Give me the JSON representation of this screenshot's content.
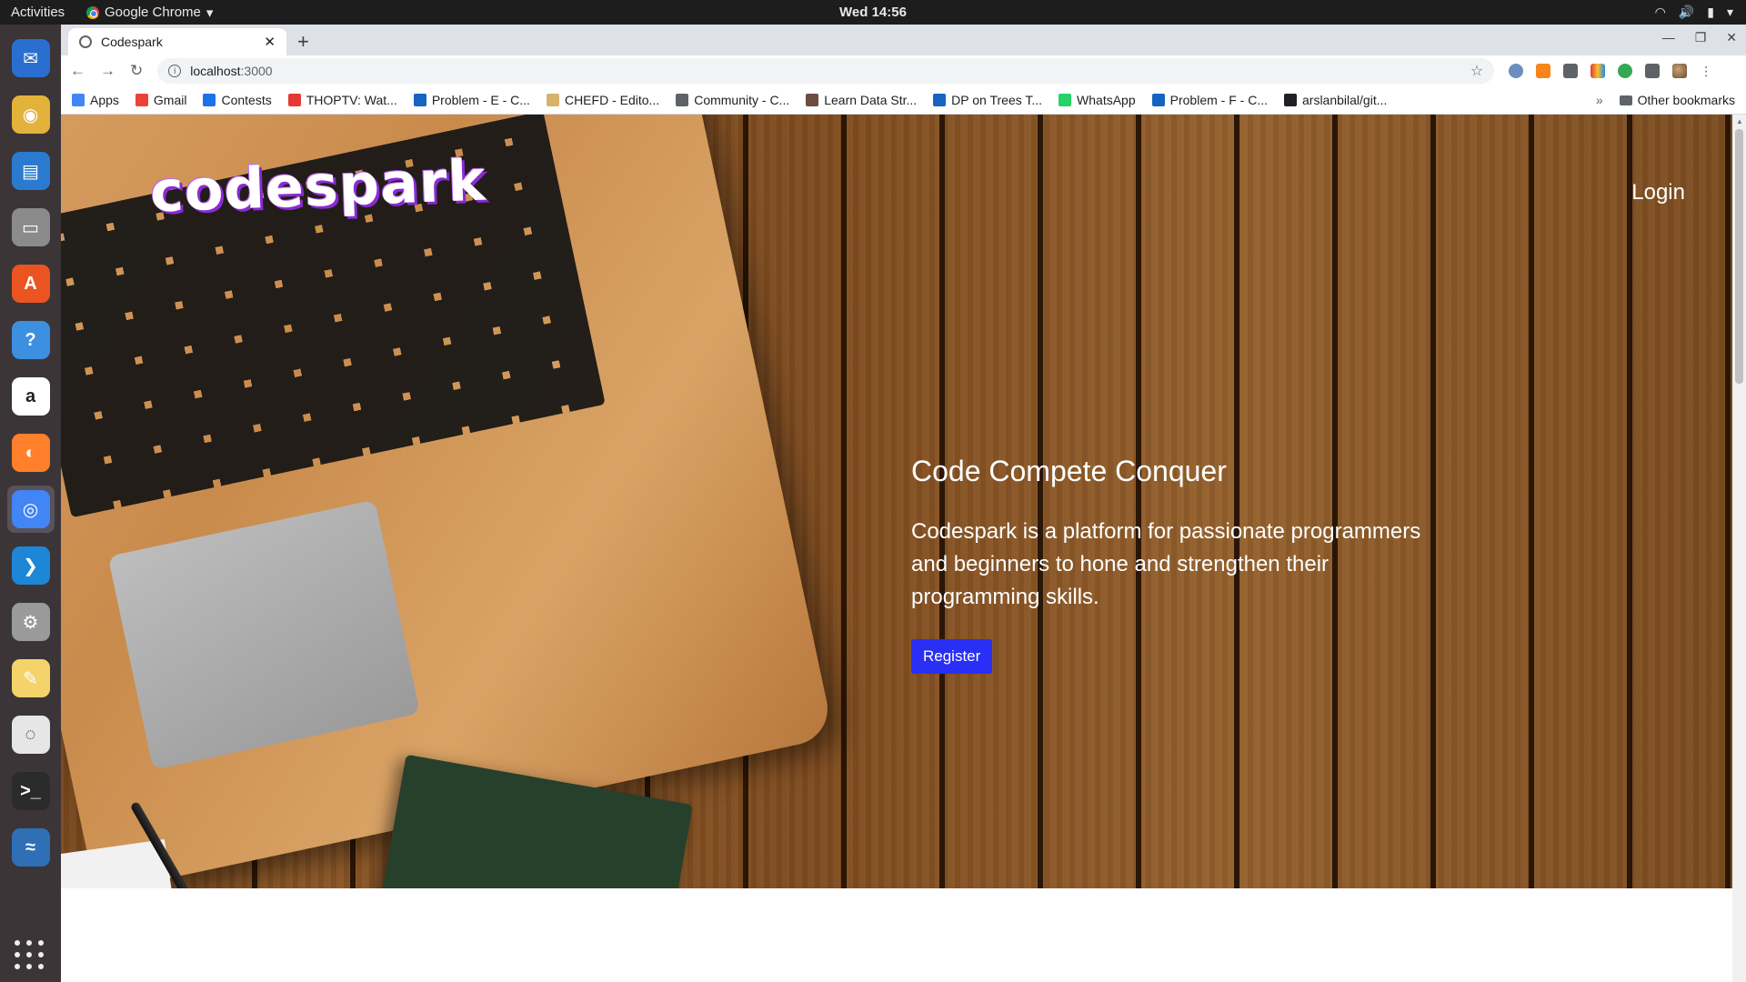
{
  "system_bar": {
    "activities": "Activities",
    "app_name": "Google Chrome",
    "clock": "Wed 14:56"
  },
  "dock": {
    "apps": [
      {
        "name": "thunderbird",
        "color": "#2a6fd0",
        "glyph": "✉"
      },
      {
        "name": "rhythmbox",
        "color": "#e2b23a",
        "glyph": "◉"
      },
      {
        "name": "libreoffice-writer",
        "color": "#2a7bd0",
        "glyph": "▤"
      },
      {
        "name": "files",
        "color": "#8b8b8b",
        "glyph": "▭"
      },
      {
        "name": "ubuntu-software",
        "color": "#e95420",
        "glyph": "A"
      },
      {
        "name": "help",
        "color": "#3d8fe0",
        "glyph": "?"
      },
      {
        "name": "amazon",
        "color": "#ffffff",
        "glyph": "a"
      },
      {
        "name": "firefox",
        "color": "#ff7f2a",
        "glyph": "◐"
      },
      {
        "name": "chrome",
        "color": "#4285f4",
        "glyph": "◎"
      },
      {
        "name": "vscode",
        "color": "#1e86d6",
        "glyph": "❯"
      },
      {
        "name": "settings",
        "color": "#9a9a9a",
        "glyph": "⚙"
      },
      {
        "name": "text-editor",
        "color": "#f4d36a",
        "glyph": "✎"
      },
      {
        "name": "pdf-viewer",
        "color": "#e6e6e6",
        "glyph": "◌"
      },
      {
        "name": "terminal",
        "color": "#2b2b2b",
        "glyph": ">_"
      },
      {
        "name": "wireshark",
        "color": "#2f6fb5",
        "glyph": "≈"
      }
    ]
  },
  "browser": {
    "tab_title": "Codespark",
    "url_host": "localhost",
    "url_port": ":3000",
    "bookmarks": [
      {
        "label": "Apps",
        "color": "#4285f4"
      },
      {
        "label": "Gmail",
        "color": "#ea4335"
      },
      {
        "label": "Contests",
        "color": "#1a73e8"
      },
      {
        "label": "THOPTV: Wat...",
        "color": "#e53935"
      },
      {
        "label": "Problem - E - C...",
        "color": "#1565c0"
      },
      {
        "label": "CHEFD - Edito...",
        "color": "#d9b26a"
      },
      {
        "label": "Community - C...",
        "color": "#5f6368"
      },
      {
        "label": "Learn Data Str...",
        "color": "#6d4c41"
      },
      {
        "label": "DP on Trees T...",
        "color": "#1565c0"
      },
      {
        "label": "WhatsApp",
        "color": "#25d366"
      },
      {
        "label": "Problem - F - C...",
        "color": "#1565c0"
      },
      {
        "label": "arslanbilal/git...",
        "color": "#202124"
      }
    ],
    "other_bookmarks": "Other bookmarks"
  },
  "page": {
    "logo": "codespark",
    "login": "Login",
    "headline": "Code Compete Conquer",
    "description": "Codespark is a platform for passionate programmers and beginners to hone and strengthen their programming skills.",
    "register": "Register",
    "accent": "#2a2ff5"
  }
}
